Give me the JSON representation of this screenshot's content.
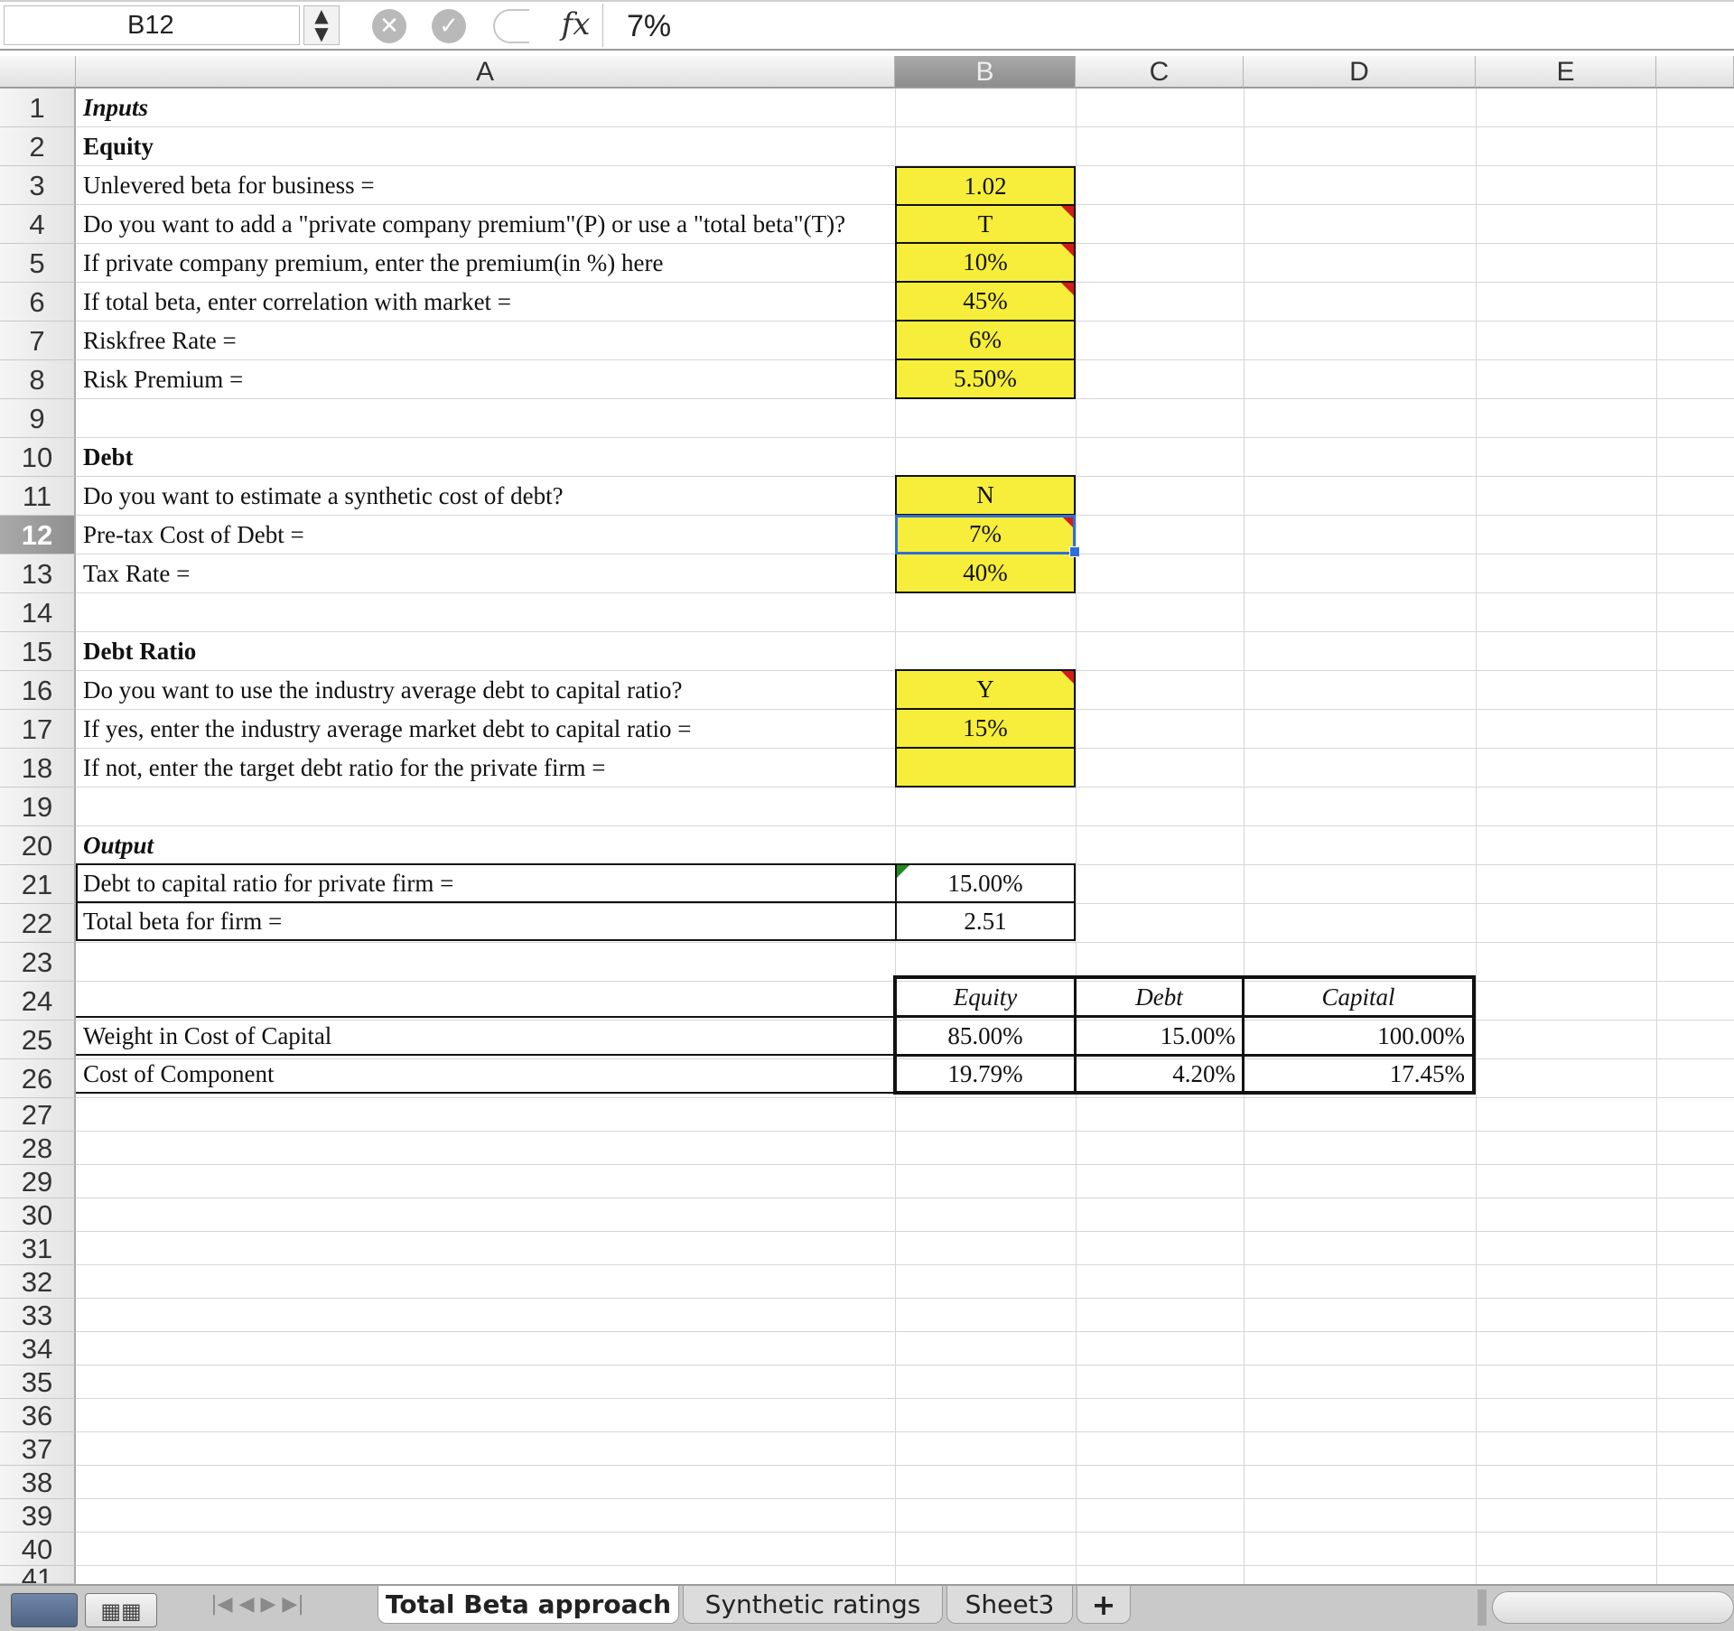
{
  "formula_bar": {
    "cell_ref": "B12",
    "stepper_icon": "▲▼",
    "cancel_icon": "✕",
    "confirm_icon": "✓",
    "fx_label": "fx",
    "formula": "7%"
  },
  "columns": [
    "A",
    "B",
    "C",
    "D",
    "E"
  ],
  "rows": [
    "1",
    "2",
    "3",
    "4",
    "5",
    "6",
    "7",
    "8",
    "9",
    "10",
    "11",
    "12",
    "13",
    "14",
    "15",
    "16",
    "17",
    "18",
    "19",
    "20",
    "21",
    "22",
    "23",
    "24",
    "25",
    "26",
    "27",
    "28",
    "29",
    "30",
    "31",
    "32",
    "33",
    "34",
    "35",
    "36",
    "37",
    "38",
    "39",
    "40",
    "41"
  ],
  "cells": {
    "A1": "Inputs",
    "A2": "Equity",
    "A3": "Unlevered beta  for business =",
    "B3": "1.02",
    "A4": "Do you want to add a \"private company premium\"(P) or use a \"total beta\"(T)?",
    "B4": "T",
    "A5": "If private company premium, enter the premium(in %) here",
    "B5": "10%",
    "A6": "If total beta, enter correlation with market =",
    "B6": "45%",
    "A7": "Riskfree Rate =",
    "B7": "6%",
    "A8": "Risk Premium =",
    "B8": "5.50%",
    "A10": "Debt",
    "A11": "Do you want to estimate a synthetic cost of debt?",
    "B11": "N",
    "A12": "Pre-tax Cost of Debt =",
    "B12": "7%",
    "A13": "Tax Rate =",
    "B13": "40%",
    "A15": "Debt Ratio",
    "A16": "Do you want to use the industry average debt to capital ratio?",
    "B16": "Y",
    "A17": "If yes, enter the industry average market debt to capital ratio =",
    "B17": "15%",
    "A18": "If not, enter the target debt ratio for the private firm =",
    "A20": "Output",
    "A21": "Debt to capital ratio for private firm =",
    "B21": "15.00%",
    "A22": "Total beta for firm =",
    "B22": "2.51",
    "B24": "Equity",
    "C24": "Debt",
    "D24": "Capital",
    "A25": "Weight in Cost of Capital",
    "B25": "85.00%",
    "C25": "15.00%",
    "D25": "100.00%",
    "A26": "Cost of Component",
    "B26": "19.79%",
    "C26": "4.20%",
    "D26": "17.45%"
  },
  "sheet_tabs": {
    "nav_icons": "|◀ ◀ ▶ ▶|",
    "tab1": "Total Beta approach",
    "tab2": "Synthetic ratings",
    "tab3": "Sheet3",
    "add": "+"
  },
  "colors": {
    "input_fill": "#f6ee3a",
    "note_marker": "#d21b1b",
    "selection": "#2f6fd6"
  }
}
